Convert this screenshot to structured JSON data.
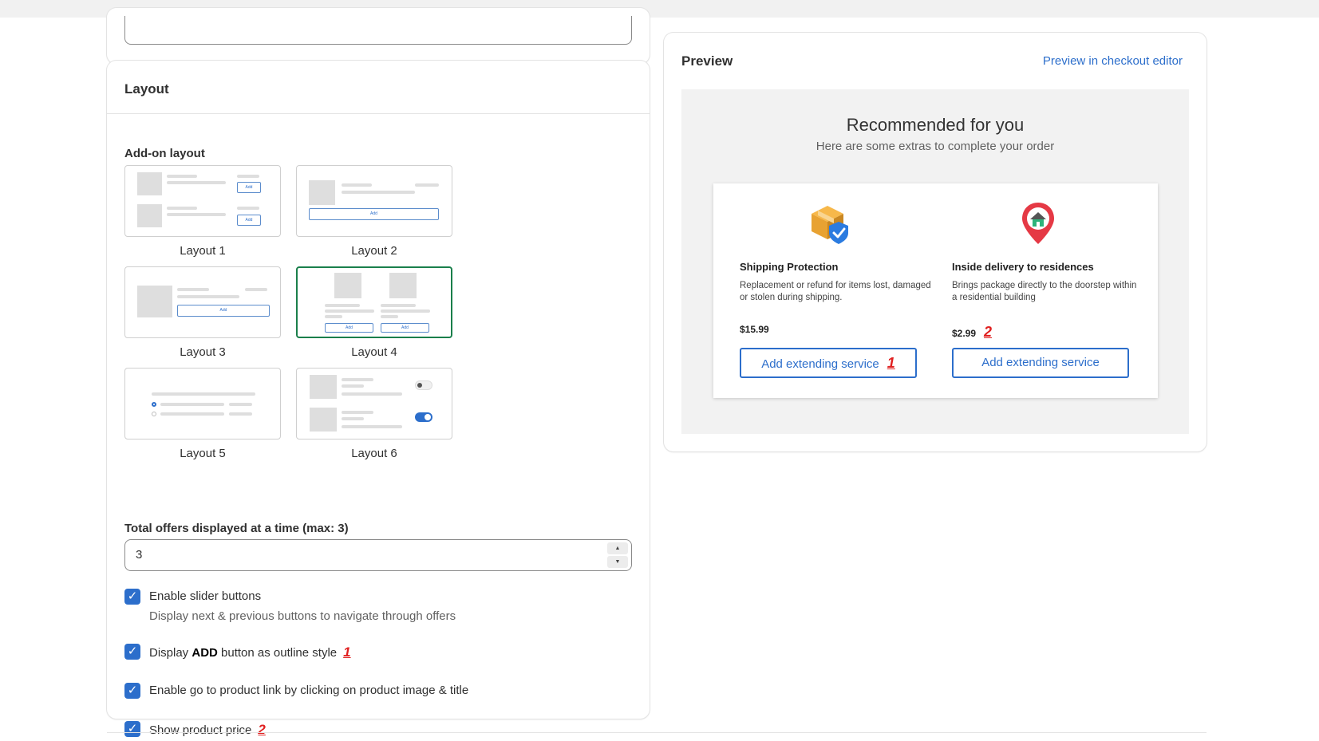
{
  "layout_card": {
    "title": "Layout",
    "section_label": "Add-on layout",
    "options": [
      {
        "label": "Layout 1",
        "btn": "Add"
      },
      {
        "label": "Layout 2",
        "btn": "Add"
      },
      {
        "label": "Layout 3",
        "btn": "Add"
      },
      {
        "label": "Layout 4",
        "btn": "Add",
        "selected": true
      },
      {
        "label": "Layout 5"
      },
      {
        "label": "Layout 6"
      }
    ],
    "total_offers_label": "Total offers displayed at a time (max: 3)",
    "total_offers_value": "3",
    "checkboxes": {
      "slider": {
        "label": "Enable slider buttons",
        "help": "Display next & previous buttons to navigate through offers",
        "checked": true
      },
      "outline": {
        "prefix": "Display ",
        "bold": "ADD",
        "suffix": " button as outline style",
        "marker": "1",
        "checked": true
      },
      "product_link": {
        "label": "Enable go to product link by clicking on product image & title",
        "checked": true
      },
      "price": {
        "label": "Show product price",
        "marker": "2",
        "checked": true
      }
    }
  },
  "preview": {
    "title": "Preview",
    "link": "Preview in checkout editor",
    "heading": "Recommended for you",
    "subheading": "Here are some extras to complete your order",
    "offers": [
      {
        "name": "Shipping Protection",
        "desc": "Replacement or refund for items lost, damaged or stolen during shipping.",
        "price": "$15.99",
        "button": "Add extending service",
        "button_marker": "1",
        "icon": "package-shield-icon"
      },
      {
        "name": "Inside delivery to residences",
        "desc": "Brings package directly to the doorstep within a residential building",
        "price": "$2.99",
        "price_marker": "2",
        "button": "Add extending service",
        "icon": "location-pin-house-icon"
      }
    ]
  },
  "colors": {
    "accent": "#2c6ecb",
    "selected_border": "#1a7f4b",
    "marker": "#e02020"
  }
}
